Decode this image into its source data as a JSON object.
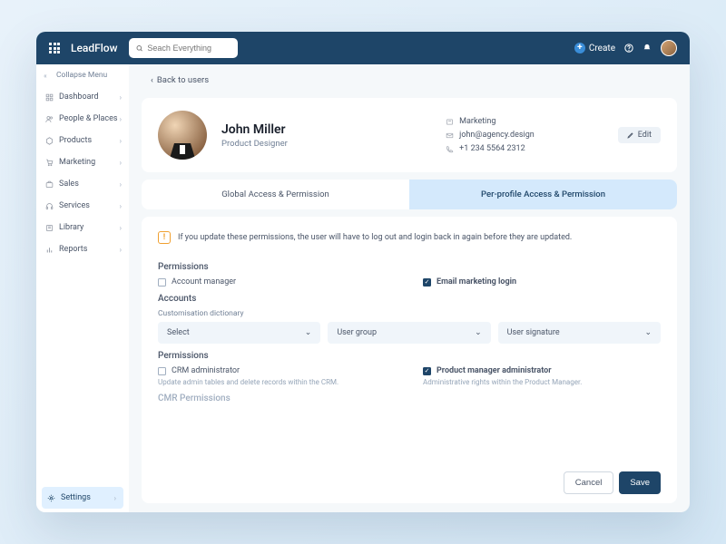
{
  "brand": "LeadFlow",
  "search_placeholder": "Seach Everything",
  "create_label": "Create",
  "sidebar": {
    "collapse": "Collapse Menu",
    "items": [
      {
        "label": "Dashboard"
      },
      {
        "label": "People & Places"
      },
      {
        "label": "Products"
      },
      {
        "label": "Marketing"
      },
      {
        "label": "Sales"
      },
      {
        "label": "Services"
      },
      {
        "label": "Library"
      },
      {
        "label": "Reports"
      }
    ],
    "settings": "Settings"
  },
  "back": "Back to users",
  "profile": {
    "name": "John Miller",
    "role": "Product Designer",
    "dept": "Marketing",
    "email": "john@agency.design",
    "phone": "+1 234 5564 2312",
    "edit": "Edit"
  },
  "tabs": {
    "global": "Global Access & Permission",
    "perprofile": "Per-profile Access & Permission"
  },
  "alert": "If you update these permissions, the user will have to log out and login back in again before they are updated.",
  "sections": {
    "perm1": "Permissions",
    "accounts": "Accounts",
    "perm2": "Permissions",
    "cmr": "CMR Permissions"
  },
  "perms": {
    "account_manager": "Account manager",
    "email_marketing": "Email marketing login",
    "crm_admin": "CRM administrator",
    "crm_admin_help": "Update admin tables and delete records within the CRM.",
    "pm_admin": "Product manager administrator",
    "pm_admin_help": "Administrative rights within the Product Manager."
  },
  "accounts": {
    "dict_label": "Customisation dictionary",
    "select1": "Select",
    "select2": "User group",
    "select3": "User signature"
  },
  "buttons": {
    "cancel": "Cancel",
    "save": "Save"
  }
}
